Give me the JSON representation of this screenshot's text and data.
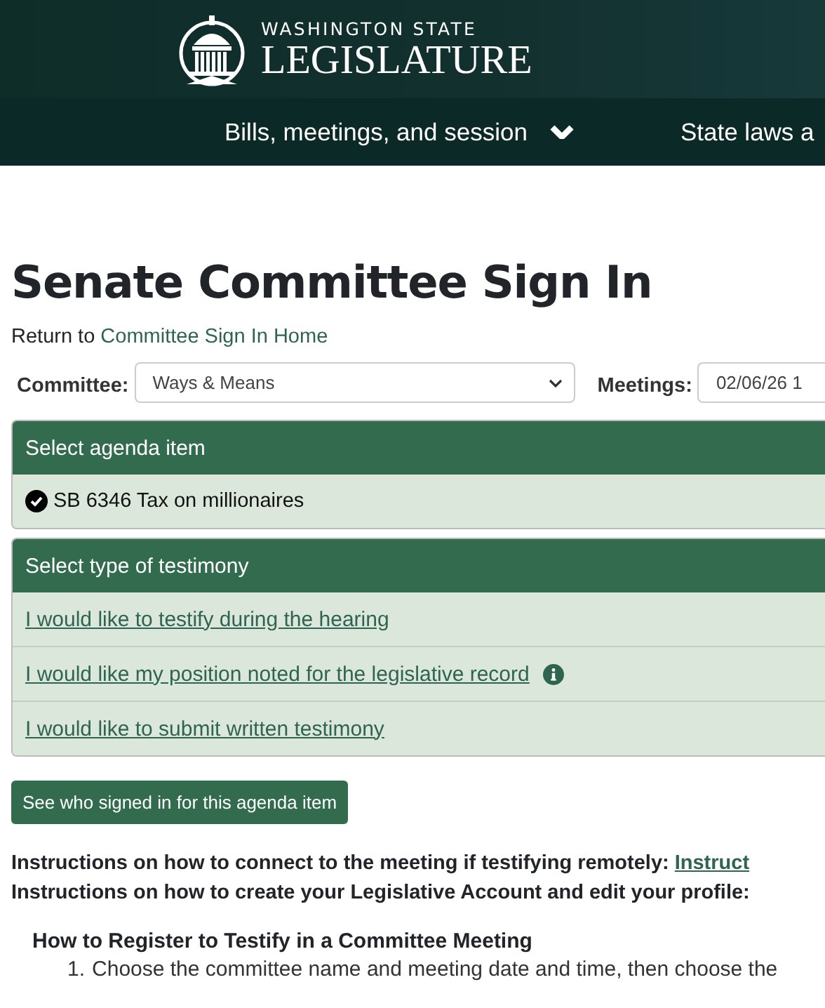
{
  "header": {
    "logo_top": "WASHINGTON STATE",
    "logo_bottom": "LEGISLATURE"
  },
  "nav": [
    {
      "label": "Bills, meetings, and session",
      "dropdown": true
    },
    {
      "label": "State laws a",
      "dropdown": false
    }
  ],
  "page_title": "Senate Committee Sign In",
  "return_line": {
    "text": "Return to",
    "link": "Committee Sign In Home"
  },
  "filters": [
    {
      "label": "Committee:",
      "value": "Ways & Means",
      "dropdown": true
    },
    {
      "label": "Meetings:",
      "value": "02/06/26 1",
      "dropdown": false
    }
  ],
  "agenda": {
    "title": "Select agenda item",
    "items": [
      {
        "label": "SB 6346 Tax on millionaires",
        "selected": true
      }
    ]
  },
  "testimony": {
    "title": "Select type of testimony",
    "options": [
      {
        "label": "I would like to testify during the hearing",
        "info": false
      },
      {
        "label": "I would like my position noted for the legislative record",
        "info": true
      },
      {
        "label": "I would like to submit written testimony",
        "info": false
      }
    ]
  },
  "signed_in_button": "See who signed in for this agenda item",
  "instructions": [
    {
      "text": "Instructions on how to connect to the meeting if testifying remotely:",
      "link": "Instruct"
    },
    {
      "text": "Instructions on how to create your Legislative Account and edit your profile:"
    }
  ],
  "how_to": {
    "title": "How to Register to Testify in a Committee Meeting",
    "steps": [
      {
        "number": "1.",
        "text": "Choose the committee name and meeting date and time, then choose the"
      }
    ]
  }
}
